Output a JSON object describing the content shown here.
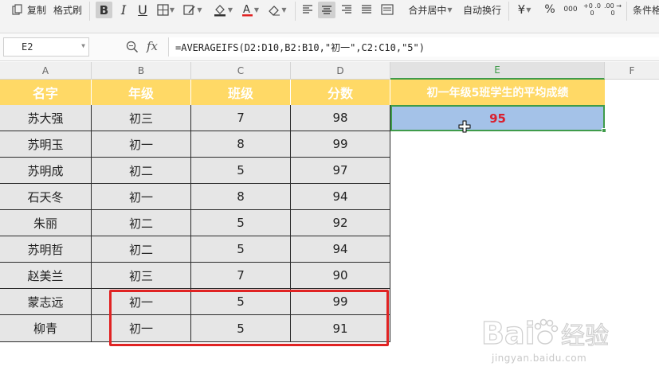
{
  "toolbar": {
    "copy_label": "复制",
    "format_painter_label": "格式刷",
    "bold_label": "B",
    "italic_label": "I",
    "underline_label": "U",
    "merge_center_label": "合并居中",
    "wrap_text_label": "自动换行",
    "currency_label": "¥",
    "percent_label": "%",
    "thousands_label": "000",
    "increase_decimal_label": "+0 .00",
    "decrease_decimal_label": ".00 →0",
    "conditional_format_label": "条件格"
  },
  "formula_bar": {
    "name_box": "E2",
    "fx_label": "fx",
    "formula": "=AVERAGEIFS(D2:D10,B2:B10,\"初一\",C2:C10,\"5\")"
  },
  "columns": [
    "A",
    "B",
    "C",
    "D",
    "E",
    "F"
  ],
  "selected_column": "E",
  "table": {
    "headers": [
      "名字",
      "年级",
      "班级",
      "分数"
    ],
    "rows": [
      [
        "苏大强",
        "初三",
        "7",
        "98"
      ],
      [
        "苏明玉",
        "初一",
        "8",
        "99"
      ],
      [
        "苏明成",
        "初二",
        "5",
        "97"
      ],
      [
        "石天冬",
        "初一",
        "8",
        "94"
      ],
      [
        "朱丽",
        "初二",
        "5",
        "92"
      ],
      [
        "苏明哲",
        "初二",
        "5",
        "94"
      ],
      [
        "赵美兰",
        "初三",
        "7",
        "90"
      ],
      [
        "蒙志远",
        "初一",
        "5",
        "99"
      ],
      [
        "柳青",
        "初一",
        "5",
        "91"
      ]
    ]
  },
  "result": {
    "header": "初一年级5班学生的平均成绩",
    "value": "95"
  },
  "colors": {
    "header_fill": "#ffd966",
    "data_fill": "#e6e6e6",
    "result_fill": "#a4c2e8",
    "result_text": "#d9202f",
    "selection": "#3f9b4a",
    "highlight_box": "#e02323"
  },
  "watermark": {
    "logo_text": "Baidu经验",
    "url": "jingyan.baidu.com"
  }
}
